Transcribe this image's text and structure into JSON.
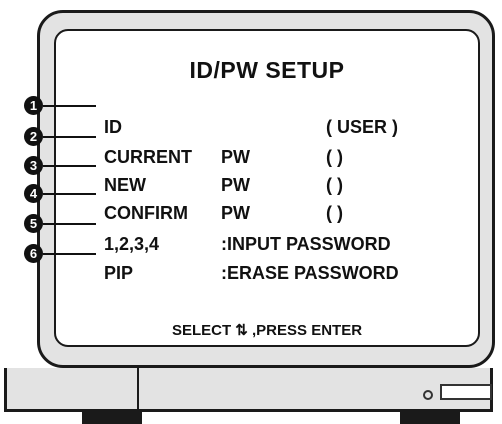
{
  "screen": {
    "title": "ID/PW SETUP",
    "rows": [
      {
        "marker": "1",
        "label": "ID",
        "mid": "",
        "value": "( USER )"
      },
      {
        "marker": "2",
        "label": "CURRENT",
        "mid": "PW",
        "value": "(        )"
      },
      {
        "marker": "3",
        "label": "NEW",
        "mid": "PW",
        "value": "(        )"
      },
      {
        "marker": "4",
        "label": "CONFIRM",
        "mid": "PW",
        "value": "(        )"
      },
      {
        "marker": "5",
        "label": "1,2,3,4",
        "mid": ":INPUT  PASSWORD",
        "value": ""
      },
      {
        "marker": "6",
        "label": "PIP",
        "mid": ":ERASE PASSWORD",
        "value": ""
      }
    ],
    "footer": "SELECT ⇅ ,PRESS ENTER"
  },
  "markers": [
    "1",
    "2",
    "3",
    "4",
    "5",
    "6"
  ]
}
